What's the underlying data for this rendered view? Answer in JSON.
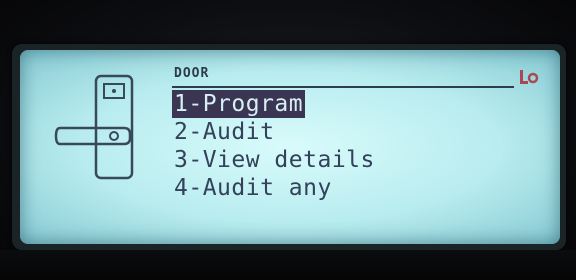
{
  "screen": {
    "title": "DOOR"
  },
  "menu": {
    "items": [
      {
        "label": "1-Program",
        "selected": true
      },
      {
        "label": "2-Audit",
        "selected": false
      },
      {
        "label": "3-View details",
        "selected": false
      },
      {
        "label": "4-Audit any",
        "selected": false
      }
    ]
  },
  "icons": {
    "door": "door-lock-icon",
    "status": "key-icon"
  },
  "colors": {
    "lcd_background": "#c6f2f4",
    "lcd_text": "#33415a",
    "selection_background": "#3a3552",
    "selection_text": "#d7eef4"
  }
}
